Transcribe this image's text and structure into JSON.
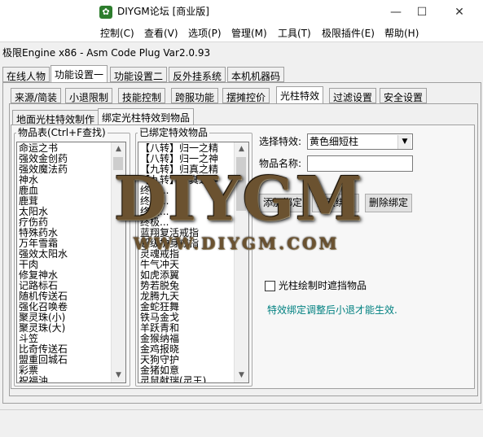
{
  "window": {
    "title": "DIYGM论坛 [商业版]",
    "minimize": "—",
    "maximize": "☐",
    "close": "✕"
  },
  "menu": [
    "控制(C)",
    "查看(V)",
    "选项(P)",
    "管理(M)",
    "工具(T)",
    "极限插件(E)",
    "帮助(H)"
  ],
  "app": {
    "engine_title": "极限Engine x86 - Asm Code Plug Var2.0.93"
  },
  "tabs_main": [
    "在线人物",
    "功能设置一",
    "功能设置二",
    "反外挂系统",
    "本机机器码"
  ],
  "tabs_sub": [
    "来源/简装",
    "小退限制",
    "技能控制",
    "跨服功能",
    "摆摊控价",
    "光柱特效",
    "过滤设置",
    "安全设置"
  ],
  "tabs_inner": [
    "地面光柱特效制作",
    "绑定光柱特效到物品"
  ],
  "items_group": {
    "title": "物品表(Ctrl+F查找)",
    "items": [
      "命运之书",
      "强效金创药",
      "强效魔法药",
      "神水",
      "鹿血",
      "鹿茸",
      "太阳水",
      "疗伤药",
      "特殊药水",
      "万年雪霜",
      "强效太阳水",
      "干肉",
      "修复神水",
      "记路标石",
      "随机传送石",
      "强化召唤卷",
      "聚灵珠(小)",
      "聚灵珠(大)",
      "斗笠",
      "比奇传送石",
      "盟重回城石",
      "彩票",
      "祝福油"
    ]
  },
  "bound_group": {
    "title": "已绑定特效物品",
    "items": [
      "【八转】归一之精",
      "【八转】归一之神",
      "【九转】归真之精",
      "【九转】归真之神",
      "终极...",
      "终极...",
      "终极...",
      "终极...",
      "蓝翔复活戒指",
      "超级护身戒指",
      "灵魂戒指",
      "牛气冲天",
      "如虎添翼",
      "势若脱兔",
      "龙腾九天",
      "金蛇狂舞",
      "铁马金戈",
      "羊跃青和",
      "金猴纳福",
      "金鸡报晓",
      "天狗守护",
      "金猪如意",
      "灵鼠献瑞(灵王)"
    ]
  },
  "effect_form": {
    "select_label": "选择特效:",
    "selected_effect": "黄色细短柱",
    "name_label": "物品名称:",
    "name_value": "",
    "add_button": "添加绑定",
    "modify_button": "修改绑定",
    "delete_button": "删除绑定",
    "checkbox_label": "光柱绘制时遮挡物品",
    "checkbox_checked": false,
    "note": "特效绑定调整后小退才能生效.",
    "note_color": "#008080"
  },
  "watermark": {
    "big": "DIYGM",
    "url": "WWW.DIYGM.COM"
  }
}
